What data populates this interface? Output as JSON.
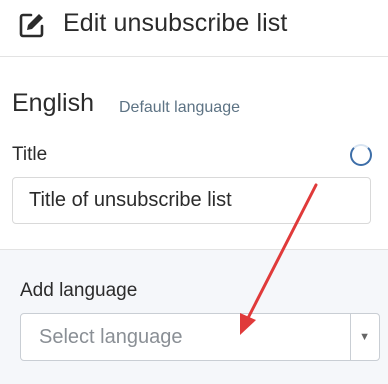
{
  "header": {
    "title": "Edit unsubscribe list",
    "icon": "edit-icon"
  },
  "language": {
    "name": "English",
    "default_label": "Default language"
  },
  "title_field": {
    "label": "Title",
    "value": "Title of unsubscribe list"
  },
  "add_language": {
    "label": "Add language",
    "placeholder": "Select language"
  },
  "colors": {
    "annotation_arrow": "#e03a3a",
    "spinner": "#3d6ea8",
    "panel_bg": "#f5f7fa"
  }
}
